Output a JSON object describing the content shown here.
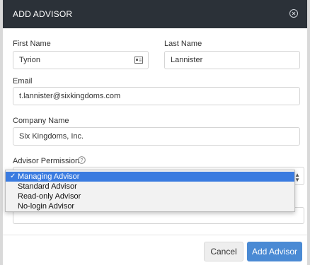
{
  "modal": {
    "title": "ADD ADVISOR",
    "close_icon": "close-circle-icon"
  },
  "form": {
    "first_name": {
      "label": "First Name",
      "value": "Tyrion",
      "icon": "id-card-icon"
    },
    "last_name": {
      "label": "Last Name",
      "value": "Lannister"
    },
    "email": {
      "label": "Email",
      "value": "t.lannister@sixkingdoms.com"
    },
    "company": {
      "label": "Company Name",
      "value": "Six Kingdoms, Inc."
    },
    "permission": {
      "label": "Advisor Permission",
      "help_icon": "question-circle-icon",
      "selected": "Managing Advisor",
      "options": [
        "Managing Advisor",
        "Standard Advisor",
        "Read-only Advisor",
        "No-login Advisor"
      ]
    }
  },
  "footer": {
    "cancel_label": "Cancel",
    "add_label": "Add Advisor"
  },
  "colors": {
    "header_bg": "#2b3138",
    "primary": "#4a8ad4",
    "selection": "#3a7be0"
  }
}
